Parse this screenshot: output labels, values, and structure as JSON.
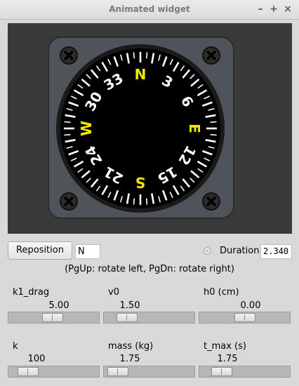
{
  "window": {
    "title": "Animated widget",
    "controls": [
      "–",
      "+",
      "×"
    ]
  },
  "compass": {
    "cardinals": [
      {
        "label": "N",
        "deg": 0
      },
      {
        "label": "E",
        "deg": 90
      },
      {
        "label": "S",
        "deg": 180
      },
      {
        "label": "W",
        "deg": 270
      }
    ],
    "numbers": [
      {
        "label": "3",
        "deg": 30
      },
      {
        "label": "6",
        "deg": 60
      },
      {
        "label": "12",
        "deg": 120
      },
      {
        "label": "15",
        "deg": 150
      },
      {
        "label": "21",
        "deg": 210
      },
      {
        "label": "24",
        "deg": 240
      },
      {
        "label": "30",
        "deg": 300
      },
      {
        "label": "33",
        "deg": 330
      }
    ],
    "colors": {
      "case": "#4e545a",
      "dial": "#000000",
      "ticks": "#ffffff",
      "cardinal": "#f0e800",
      "screw": "#111111"
    }
  },
  "controls": {
    "reposition_label": "Reposition",
    "direction_value": "N",
    "duration_label": "Duration",
    "duration_value": "2.340",
    "hint": "(PgUp: rotate left, PgDn: rotate right)"
  },
  "sliders": [
    {
      "label": "k1_drag",
      "value_text": "5.00",
      "fraction": 0.48
    },
    {
      "label": "v0",
      "value_text": "1.50",
      "fraction": 0.18
    },
    {
      "label": "h0 (cm)",
      "value_text": "0.00",
      "fraction": 0.5
    },
    {
      "label": "k",
      "value_text": "100",
      "fraction": 0.13
    },
    {
      "label": "mass (kg)",
      "value_text": "1.75",
      "fraction": 0.05
    },
    {
      "label": "t_max (s)",
      "value_text": "1.75",
      "fraction": 0.17
    }
  ]
}
